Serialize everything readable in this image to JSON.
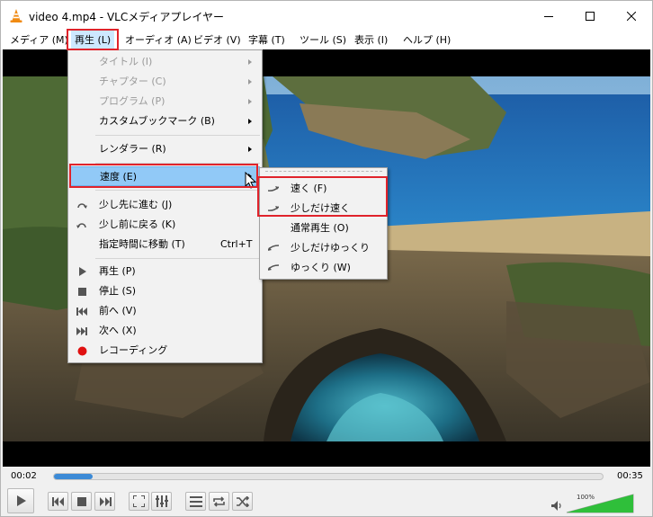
{
  "window": {
    "title": "video 4.mp4 - VLCメディアプレイヤー"
  },
  "menubar": {
    "items": [
      {
        "label": "メディア (M)"
      },
      {
        "label": "再生 (L)"
      },
      {
        "label": "オーディオ (A)"
      },
      {
        "label": "ビデオ (V)"
      },
      {
        "label": "字幕 (T)"
      },
      {
        "label": "ツール (S)"
      },
      {
        "label": "表示 (I)"
      },
      {
        "label": "ヘルプ (H)"
      }
    ]
  },
  "playback_menu": {
    "items": [
      {
        "label": "タイトル (I)",
        "enabled": false,
        "submenu": true
      },
      {
        "label": "チャプター (C)",
        "enabled": false,
        "submenu": true
      },
      {
        "label": "プログラム (P)",
        "enabled": false,
        "submenu": true
      },
      {
        "label": "カスタムブックマーク (B)",
        "enabled": true,
        "submenu": true
      },
      {
        "label": "レンダラー (R)",
        "enabled": true,
        "submenu": true
      },
      {
        "label": "速度 (E)",
        "enabled": true,
        "submenu": true,
        "highlighted": true
      },
      {
        "label": "少し先に進む (J)",
        "icon": "jump-forward-icon"
      },
      {
        "label": "少し前に戻る (K)",
        "icon": "jump-back-icon"
      },
      {
        "label": "指定時間に移動 (T)",
        "shortcut": "Ctrl+T"
      },
      {
        "label": "再生 (P)",
        "icon": "play-icon"
      },
      {
        "label": "停止 (S)",
        "icon": "stop-icon"
      },
      {
        "label": "前へ (V)",
        "icon": "previous-icon"
      },
      {
        "label": "次へ (X)",
        "icon": "next-icon"
      },
      {
        "label": "レコーディング",
        "icon": "record-icon"
      }
    ]
  },
  "speed_menu": {
    "items": [
      {
        "label": "速く (F)",
        "icon": "faster-icon"
      },
      {
        "label": "少しだけ速く",
        "icon": "faster-fine-icon"
      },
      {
        "label": "通常再生 (O)"
      },
      {
        "label": "少しだけゆっくり",
        "icon": "slower-fine-icon"
      },
      {
        "label": "ゆっくり (W)",
        "icon": "slower-icon"
      }
    ]
  },
  "controls": {
    "elapsed": "00:02",
    "total": "00:35",
    "progress_fraction": 0.07,
    "volume_label": "100%",
    "volume_fraction": 1.0
  },
  "colors": {
    "highlight": "#cde8ff",
    "menu_highlight": "#91c9f7",
    "annotation_red": "#e0232b",
    "seek_fill": "#3c8ad6",
    "volume_green": "#2fbf3a"
  }
}
